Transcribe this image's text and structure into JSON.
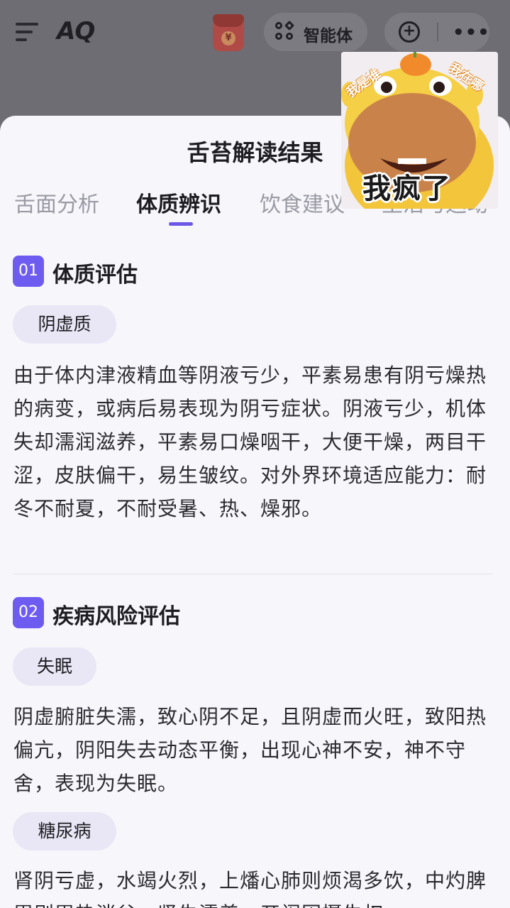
{
  "header": {
    "logo": "AQ",
    "redpacket_symbol": "¥",
    "agent_label": "智能体",
    "more_symbol": "•••",
    "new_chat_symbol": "+"
  },
  "sheet": {
    "title": "舌苔解读结果",
    "tabs": [
      {
        "label": "舌面分析"
      },
      {
        "label": "体质辨识"
      },
      {
        "label": "饮食建议"
      },
      {
        "label": "生活与运动"
      }
    ],
    "active_tab": 1,
    "sections": [
      {
        "number": "01",
        "title": "体质评估",
        "tag": "阴虚质",
        "text": "由于体内津液精血等阴液亏少，平素易患有阴亏燥热的病变，或病后易表现为阴亏症状。阴液亏少，机体失却濡润滋养，平素易口燥咽干，大便干燥，两目干涩，皮肤偏干，易生皱纹。对外界环境适应能力：耐冬不耐夏，不耐受暑、热、燥邪。"
      },
      {
        "number": "02",
        "title": "疾病风险评估",
        "items": [
          {
            "tag": "失眠",
            "text": "阴虚腑脏失濡，致心阴不足，且阴虚而火旺，致阳热偏亢，阴阳失去动态平衡，出现心神不安，神不守舍，表现为失眠。"
          },
          {
            "tag": "糖尿病",
            "text": "肾阴亏虚，水竭火烈，上燔心肺则烦渴多饮，中灼脾胃则胃热消谷，肾失濡养，开阖固摄失权"
          }
        ]
      }
    ]
  },
  "sticker": {
    "caption": "我疯了",
    "corner_left": "我是谁",
    "corner_right": "我在哪"
  },
  "colors": {
    "accent": "#6e5cf0",
    "tag_bg": "#e9e7f5",
    "sheet_bg": "#f7f6fb",
    "overlay": "#6e6d74"
  }
}
